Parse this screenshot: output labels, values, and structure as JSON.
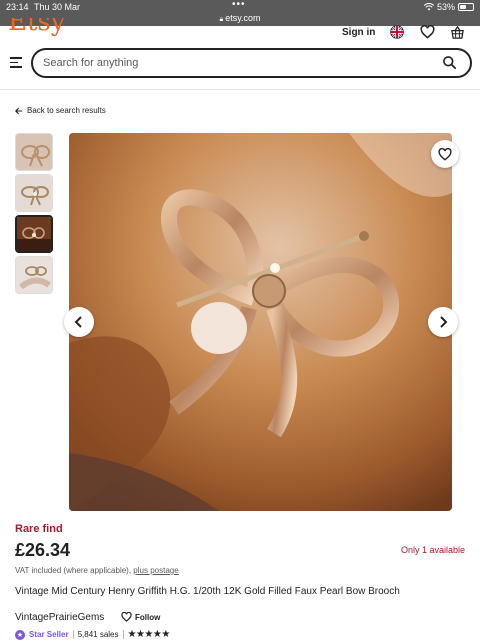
{
  "status_bar": {
    "time": "23:14",
    "date": "Thu 30 Mar",
    "url": "etsy.com",
    "battery": "53%",
    "battery_level": 0.53
  },
  "header": {
    "logo": "Etsy",
    "sign_in": "Sign in",
    "icons": [
      "uk-flag-icon",
      "heart-icon",
      "basket-icon"
    ],
    "brand_color": "#f1641e"
  },
  "search": {
    "placeholder": "Search for anything",
    "value": ""
  },
  "nav": {
    "back_label": "Back to search results"
  },
  "gallery": {
    "thumbnail_count": 4,
    "selected_index": 2
  },
  "product": {
    "badge": "Rare find",
    "price": "£26.34",
    "availability": "Only 1 available",
    "vat_text": "VAT included (where applicable),",
    "postage_link": "plus postage",
    "title": "Vintage Mid Century Henry Griffith H.G. 1/20th 12K Gold Filled Faux Pearl Bow Brooch",
    "accent_color": "#a61a2e"
  },
  "shop": {
    "name": "VintagePrairieGems",
    "follow_label": "Follow",
    "star_seller": "Star Seller",
    "sales": "5,841 sales",
    "rating_stars": 5
  }
}
